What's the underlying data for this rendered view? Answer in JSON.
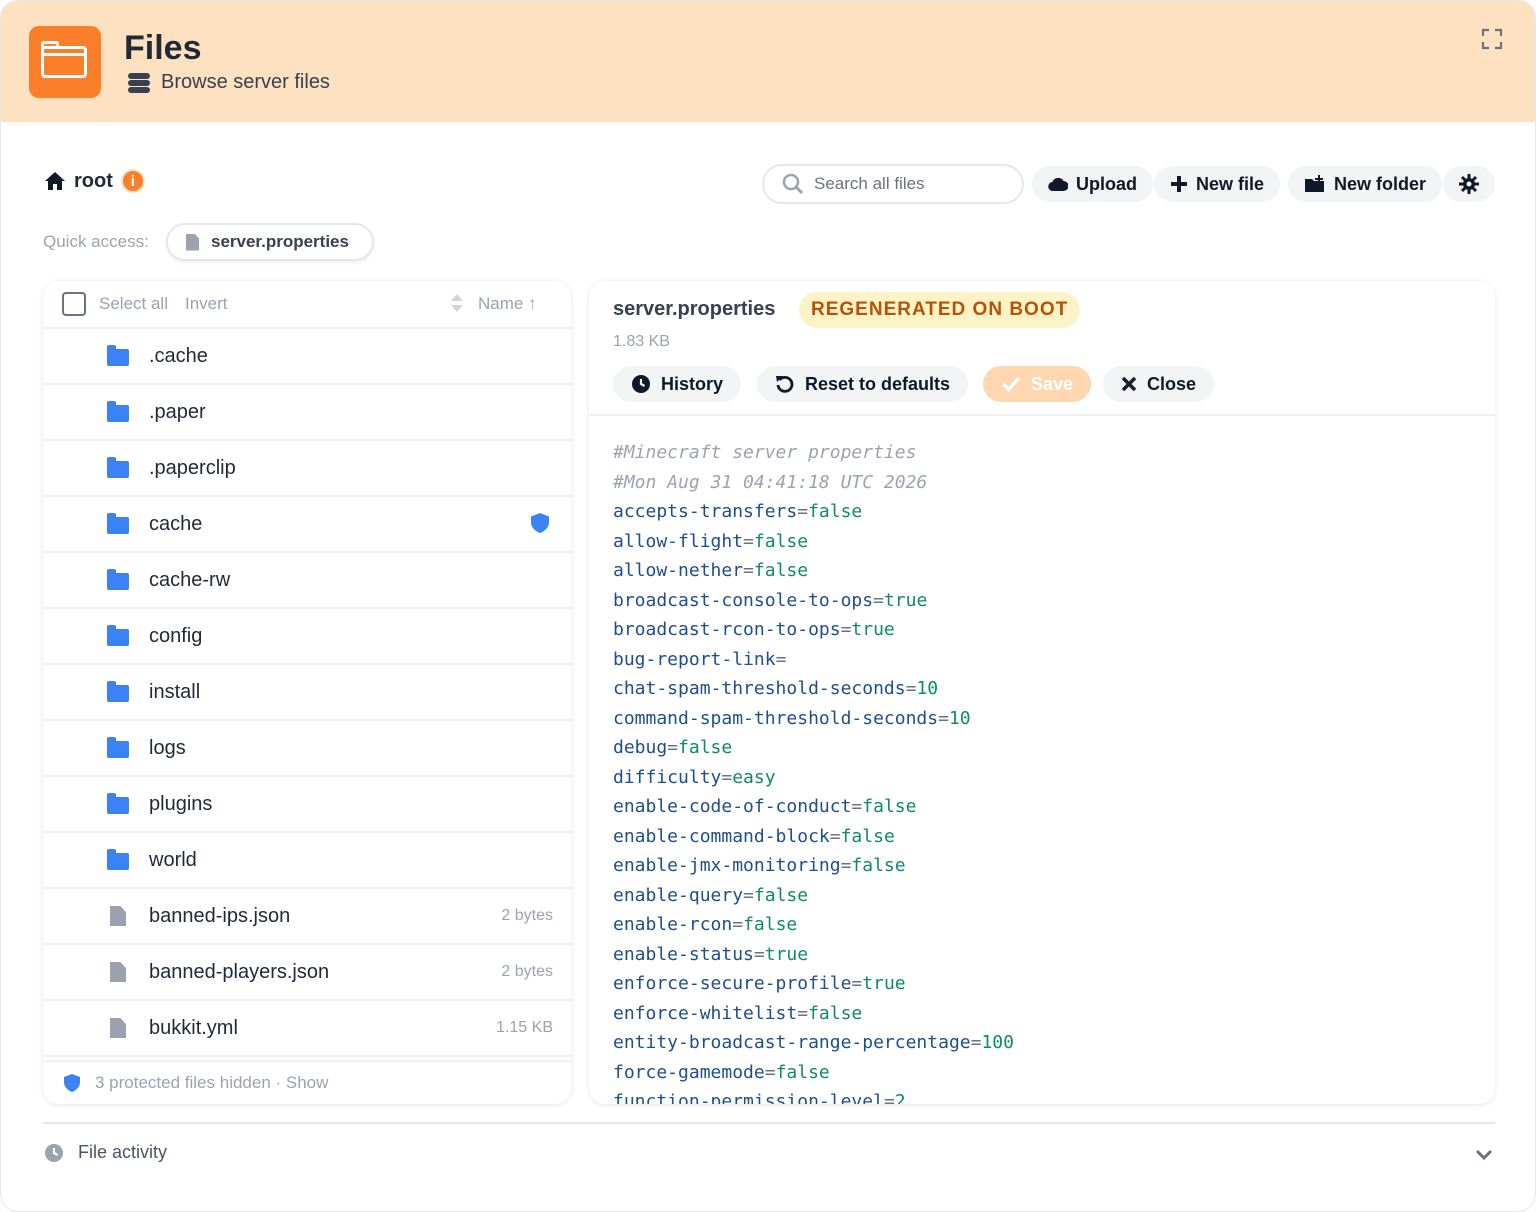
{
  "header": {
    "title": "Files",
    "subtitle": "Browse server files"
  },
  "toolbar": {
    "root_label": "root",
    "info_badge": "i",
    "search_placeholder": "Search all files",
    "upload_label": "Upload",
    "new_file_label": "New file",
    "new_folder_label": "New folder"
  },
  "quick_access": {
    "label": "Quick access:",
    "items": [
      "server.properties"
    ]
  },
  "file_list": {
    "select_all": "Select all",
    "invert": "Invert",
    "sort_label": "Name ↑",
    "items": [
      {
        "name": ".cache",
        "type": "folder",
        "size": ""
      },
      {
        "name": ".paper",
        "type": "folder",
        "size": ""
      },
      {
        "name": ".paperclip",
        "type": "folder",
        "size": ""
      },
      {
        "name": "cache",
        "type": "folder",
        "size": "",
        "protected": true
      },
      {
        "name": "cache-rw",
        "type": "folder",
        "size": ""
      },
      {
        "name": "config",
        "type": "folder",
        "size": ""
      },
      {
        "name": "install",
        "type": "folder",
        "size": ""
      },
      {
        "name": "logs",
        "type": "folder",
        "size": ""
      },
      {
        "name": "plugins",
        "type": "folder",
        "size": ""
      },
      {
        "name": "world",
        "type": "folder",
        "size": ""
      },
      {
        "name": "banned-ips.json",
        "type": "file",
        "size": "2 bytes"
      },
      {
        "name": "banned-players.json",
        "type": "file",
        "size": "2 bytes"
      },
      {
        "name": "bukkit.yml",
        "type": "file",
        "size": "1.15 KB"
      }
    ],
    "footer": "3 protected files hidden · Show"
  },
  "editor": {
    "filename": "server.properties",
    "badge": "REGENERATED ON BOOT",
    "size": "1.83 KB",
    "history_label": "History",
    "reset_label": "Reset to defaults",
    "save_label": "Save",
    "close_label": "Close",
    "comments": [
      "#Minecraft server properties",
      "#Mon Aug 31 04:41:18 UTC 2026"
    ],
    "properties": [
      {
        "key": "accepts-transfers",
        "value": "false"
      },
      {
        "key": "allow-flight",
        "value": "false"
      },
      {
        "key": "allow-nether",
        "value": "false"
      },
      {
        "key": "broadcast-console-to-ops",
        "value": "true"
      },
      {
        "key": "broadcast-rcon-to-ops",
        "value": "true"
      },
      {
        "key": "bug-report-link",
        "value": ""
      },
      {
        "key": "chat-spam-threshold-seconds",
        "value": "10"
      },
      {
        "key": "command-spam-threshold-seconds",
        "value": "10"
      },
      {
        "key": "debug",
        "value": "false"
      },
      {
        "key": "difficulty",
        "value": "easy"
      },
      {
        "key": "enable-code-of-conduct",
        "value": "false"
      },
      {
        "key": "enable-command-block",
        "value": "false"
      },
      {
        "key": "enable-jmx-monitoring",
        "value": "false"
      },
      {
        "key": "enable-query",
        "value": "false"
      },
      {
        "key": "enable-rcon",
        "value": "false"
      },
      {
        "key": "enable-status",
        "value": "true"
      },
      {
        "key": "enforce-secure-profile",
        "value": "true"
      },
      {
        "key": "enforce-whitelist",
        "value": "false"
      },
      {
        "key": "entity-broadcast-range-percentage",
        "value": "100"
      },
      {
        "key": "force-gamemode",
        "value": "false"
      },
      {
        "key": "function-permission-level",
        "value": "2"
      }
    ]
  },
  "activity": {
    "label": "File activity"
  },
  "colors": {
    "accent": "#fb7f2a",
    "header_bg": "#fde1c1",
    "folder": "#3b82f6",
    "code_key": "#1e4e8c",
    "code_value": "#0f8a6a"
  }
}
